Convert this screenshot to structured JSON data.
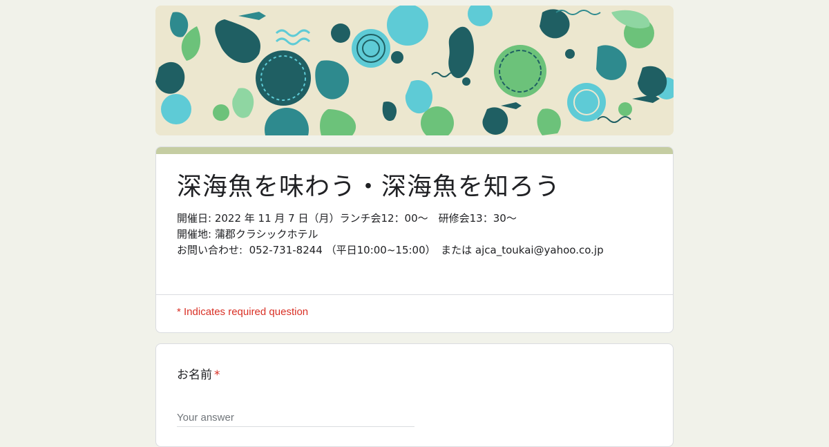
{
  "header": {
    "banner_icon": "ocean-fish-pattern-banner",
    "colors": {
      "background": "#ece7cf",
      "dark_teal": "#1f5f63",
      "teal": "#2e8a8e",
      "light_blue": "#5ecbd6",
      "green": "#6cc27a",
      "mint": "#8fd6a2"
    }
  },
  "form": {
    "title": "深海魚を味わう・深海魚を知ろう",
    "description": [
      "開催日: 2022 年 11 月 7 日（月）ランチ会12：00～　研修会13：30～",
      "開催地: 蒲郡クラシックホテル",
      "お問い合わせ:  052-731-8244 （平日10:00~15:00）　または ajca_toukai@yahoo.co.jp"
    ],
    "required_note": "* Indicates required question",
    "accent_color": "#c5cda2",
    "required_color": "#d93025"
  },
  "questions": [
    {
      "label": "お名前",
      "required_mark": "*",
      "placeholder": "Your answer"
    }
  ]
}
